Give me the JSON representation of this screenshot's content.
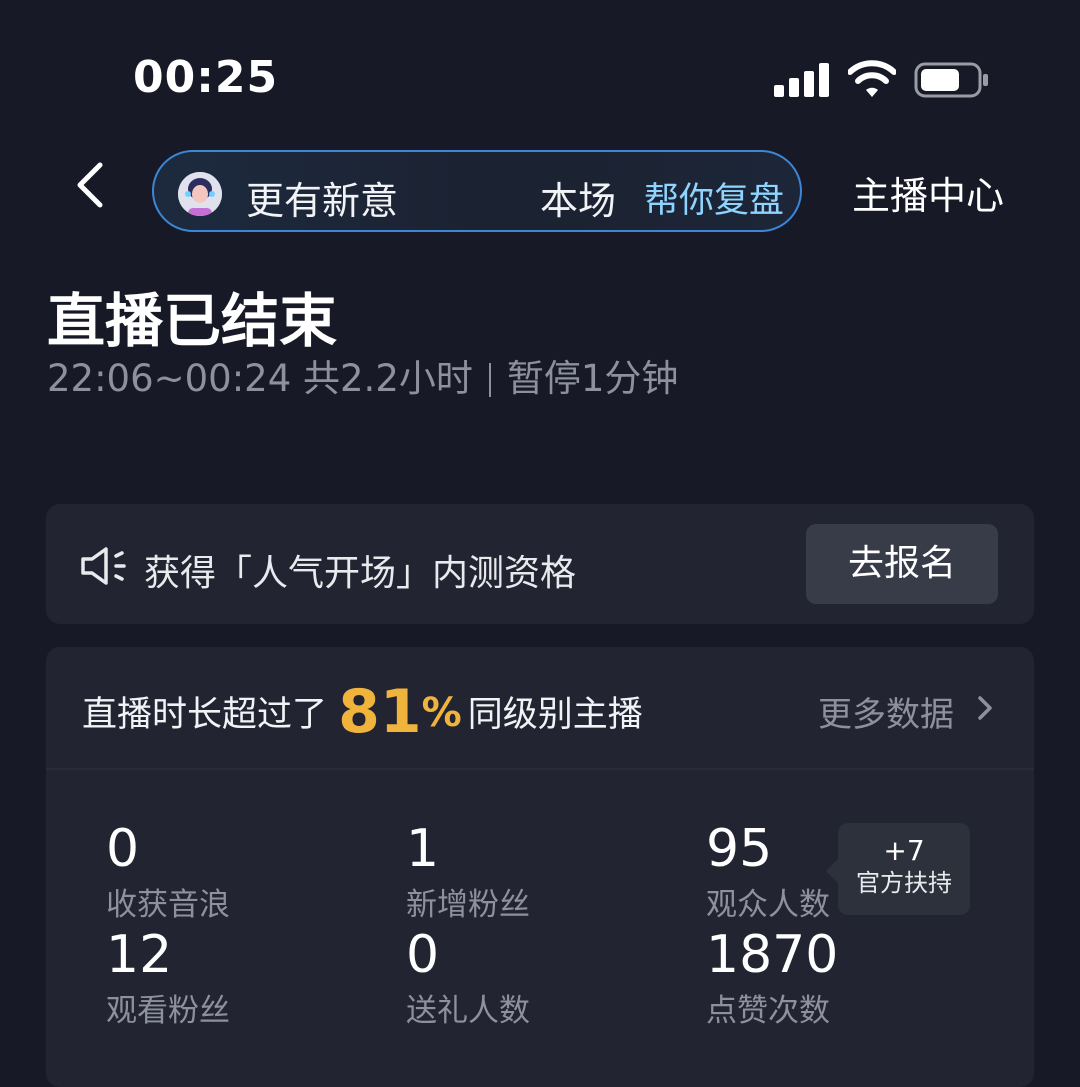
{
  "status_bar": {
    "time": "00:25"
  },
  "header": {
    "tagline": "更有新意",
    "scene": "本场",
    "replay": "帮你复盘",
    "host_center": "主播中心"
  },
  "summary": {
    "title": "直播已结束",
    "time_range": "22:06~00:24 共2.2小时",
    "pause": "暂停1分钟"
  },
  "banner": {
    "text": "获得「人气开场」内测资格",
    "button": "去报名"
  },
  "stats": {
    "headline_prefix": "直播时长超过了",
    "percent": "81",
    "percent_sign": "%",
    "headline_suffix": "同级别主播",
    "more_label": "更多数据",
    "items": [
      {
        "value": "0",
        "label": "收获音浪"
      },
      {
        "value": "1",
        "label": "新增粉丝"
      },
      {
        "value": "95",
        "label": "观众人数"
      },
      {
        "value": "12",
        "label": "观看粉丝"
      },
      {
        "value": "0",
        "label": "送礼人数"
      },
      {
        "value": "1870",
        "label": "点赞次数"
      }
    ],
    "support": {
      "plus": "+7",
      "caption": "官方扶持"
    }
  }
}
